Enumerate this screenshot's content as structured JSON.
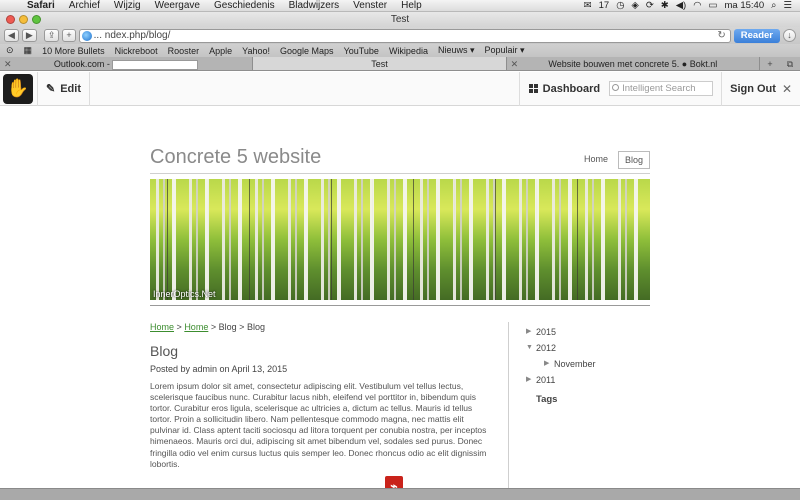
{
  "menubar": {
    "items": [
      "Safari",
      "Archief",
      "Wijzig",
      "Weergave",
      "Geschiedenis",
      "Bladwijzers",
      "Venster",
      "Help"
    ],
    "status": {
      "badge": "17",
      "clock": "ma 15:40"
    }
  },
  "window": {
    "title": "Test"
  },
  "toolbar": {
    "url": "... ndex.php/blog/",
    "reader_label": "Reader"
  },
  "bookmarks": [
    "10 More Bullets",
    "Nickreboot",
    "Rooster",
    "Apple",
    "Yahoo!",
    "Google Maps",
    "YouTube",
    "Wikipedia",
    "Nieuws ▾",
    "Populair ▾"
  ],
  "tabs": [
    {
      "label": "Outlook.com -",
      "active": false
    },
    {
      "label": "Test",
      "active": true
    },
    {
      "label": "Website bouwen met concrete 5. ● Bokt.nl",
      "active": false
    }
  ],
  "c5": {
    "edit_label": "Edit",
    "dashboard_label": "Dashboard",
    "search_placeholder": "Intelligent Search",
    "signout_label": "Sign Out"
  },
  "site": {
    "title": "Concrete 5 website",
    "nav": [
      {
        "label": "Home",
        "selected": false
      },
      {
        "label": "Blog",
        "selected": true
      }
    ],
    "hero_caption": "InnerOptics.Net"
  },
  "breadcrumb": {
    "home1": "Home",
    "home2": "Home",
    "blog1": "Blog",
    "blog2": "Blog",
    "sep": ">"
  },
  "post": {
    "title": "Blog",
    "meta": "Posted by admin on April 13, 2015",
    "body": "Lorem ipsum dolor sit amet, consectetur adipiscing elit. Vestibulum vel tellus lectus, scelerisque faucibus nunc. Curabitur lacus nibh, eleifend vel porttitor in, bibendum quis tortor. Curabitur eros ligula, scelerisque ac ultricies a, dictum ac tellus. Mauris id tellus tortor. Proin a sollicitudin libero. Nam pellentesque commodo magna, nec mattis elit pulvinar id. Class aptent taciti sociosqu ad litora torquent per conubia nostra, per inceptos himenaeos. Mauris orci dui, adipiscing sit amet bibendum vel, sodales sed purus. Donec fringilla odio vel enim cursus luctus quis semper leo. Donec rhoncus odio ac elit dignissim lobortis."
  },
  "archive": [
    {
      "label": "2015",
      "expanded": false,
      "level": 0
    },
    {
      "label": "2012",
      "expanded": true,
      "level": 0
    },
    {
      "label": "November",
      "expanded": false,
      "level": 1
    },
    {
      "label": "2011",
      "expanded": false,
      "level": 0
    }
  ],
  "tags_heading": "Tags",
  "colors": {
    "accent_link": "#3c8d2f",
    "reader_blue": "#3a7fd9",
    "pdf_red": "#c9231b"
  }
}
